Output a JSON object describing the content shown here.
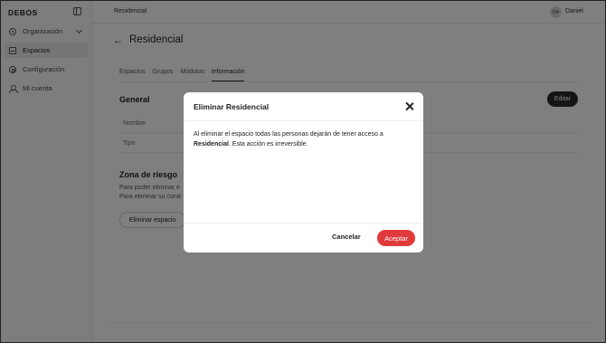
{
  "sidebar": {
    "brand": "DEBOS",
    "items": [
      {
        "label": "Organización",
        "icon": "organization-icon"
      },
      {
        "label": "Espacios",
        "icon": "spaces-icon"
      },
      {
        "label": "Configuración",
        "icon": "gear-icon"
      },
      {
        "label": "Mi cuenta",
        "icon": "user-icon"
      }
    ]
  },
  "topbar": {
    "breadcrumb": "Residencial",
    "avatar_initials": "DA",
    "username": "Daniel"
  },
  "page": {
    "title": "Residencial",
    "tabs": [
      "Espacios",
      "Grupos",
      "Módulos",
      "Información"
    ],
    "general_title": "General",
    "edit_label": "Editar",
    "fields": [
      "Nombre",
      "Tipo"
    ],
    "danger_title": "Zona de riesgo",
    "danger_line1": "Para poder eliminar e",
    "danger_line2": "Para eliminar su cond",
    "delete_space_label": "Eliminar espacio"
  },
  "modal": {
    "title": "Eliminar Residencial",
    "body_prefix": "Al eliminar el espacio todas las personas dejarán de tener acceso a ",
    "body_bold": "Residencial",
    "body_suffix": ". Esta acción es irreversible.",
    "cancel_label": "Cancelar",
    "accept_label": "Aceptar"
  },
  "colors": {
    "accent_danger": "#e03a3a",
    "overlay": "rgba(0,0,0,0.5)"
  }
}
